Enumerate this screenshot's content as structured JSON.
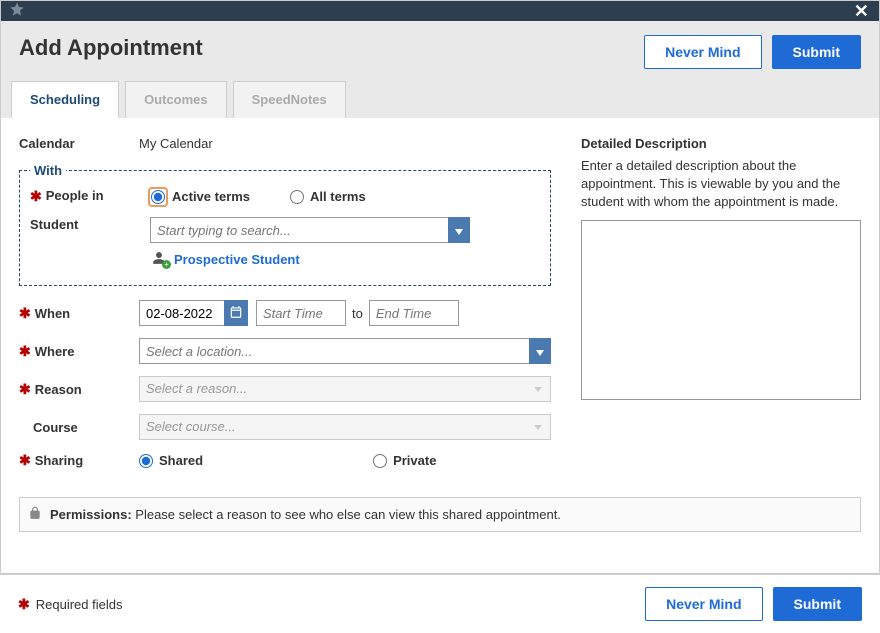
{
  "header": {
    "title": "Add Appointment"
  },
  "buttons": {
    "never_mind": "Never Mind",
    "submit": "Submit"
  },
  "tabs": {
    "scheduling": "Scheduling",
    "outcomes": "Outcomes",
    "speednotes": "SpeedNotes"
  },
  "form": {
    "calendar_label": "Calendar",
    "calendar_value": "My Calendar",
    "with_legend": "With",
    "people_in_label": "People in",
    "active_terms": "Active terms",
    "all_terms": "All terms",
    "student_label": "Student",
    "student_placeholder": "Start typing to search...",
    "prospective_link": "Prospective Student",
    "when_label": "When",
    "when_date": "02-08-2022",
    "start_time_placeholder": "Start Time",
    "to": "to",
    "end_time_placeholder": "End Time",
    "where_label": "Where",
    "where_placeholder": "Select a location...",
    "reason_label": "Reason",
    "reason_placeholder": "Select a reason...",
    "course_label": "Course",
    "course_placeholder": "Select course...",
    "sharing_label": "Sharing",
    "shared": "Shared",
    "private": "Private"
  },
  "description": {
    "title": "Detailed Description",
    "body": "Enter a detailed description about the appointment. This is viewable by you and the student with whom the appointment is made."
  },
  "permissions": {
    "label": "Permissions:",
    "text": "Please select a reason to see who else can view this shared appointment."
  },
  "footer": {
    "required_fields": "Required fields"
  }
}
